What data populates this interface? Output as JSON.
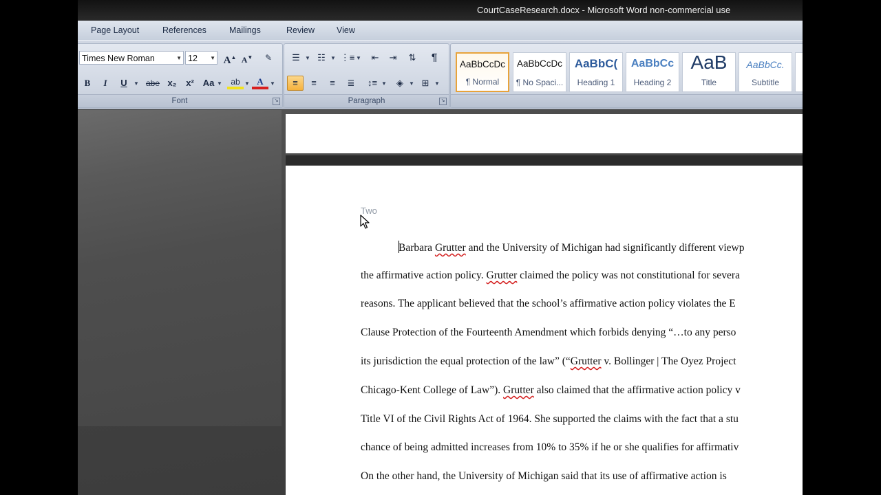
{
  "window": {
    "title": "CourtCaseResearch.docx - Microsoft Word non-commercial use"
  },
  "ribbon": {
    "tabs": [
      "Page Layout",
      "References",
      "Mailings",
      "Review",
      "View"
    ],
    "font_group": {
      "label": "Font",
      "font_name": "Times New Roman",
      "font_size": "12",
      "bold": "B",
      "italic": "I",
      "underline": "U",
      "strikethrough": "abe",
      "subscript": "x₂",
      "superscript": "x²",
      "change_case": "Aa",
      "grow_font": "A",
      "shrink_font": "A",
      "font_color": "A",
      "highlight": "ab"
    },
    "paragraph_group": {
      "label": "Paragraph",
      "show_marks": "¶"
    },
    "styles_group": {
      "styles": [
        {
          "preview": "AaBbCcDc",
          "name": "¶ Normal",
          "selected": true
        },
        {
          "preview": "AaBbCcDc",
          "name": "¶ No Spaci...",
          "selected": false
        },
        {
          "preview": "AaBbC(",
          "name": "Heading 1",
          "selected": false
        },
        {
          "preview": "AaBbCc",
          "name": "Heading 2",
          "selected": false
        },
        {
          "preview": "AaB",
          "name": "Title",
          "selected": false
        },
        {
          "preview": "AaBbCc.",
          "name": "Subtitle",
          "selected": false
        }
      ]
    }
  },
  "document": {
    "header": "Two",
    "lines": [
      {
        "segments": [
          {
            "t": "Barbara ",
            "sq": false
          },
          {
            "t": "Grutter",
            "sq": true
          },
          {
            "t": " and the University of Michigan  had significantly  different  viewp",
            "sq": false
          }
        ]
      },
      {
        "segments": [
          {
            "t": "the affirmative action policy.  ",
            "sq": false
          },
          {
            "t": "Grutter",
            "sq": true
          },
          {
            "t": " claimed  the policy was not constitutional for severa",
            "sq": false
          }
        ]
      },
      {
        "segments": [
          {
            "t": "reasons.  The  applicant  believed  that the school’s  affirmative  action policy  violates  the E",
            "sq": false
          }
        ]
      },
      {
        "segments": [
          {
            "t": "Clause Protection of the Fourteenth Amendment which forbids denying  “…to any perso",
            "sq": false
          }
        ]
      },
      {
        "segments": [
          {
            "t": "its jurisdiction  the equal protection of the law” (“",
            "sq": false
          },
          {
            "t": "Grutter",
            "sq": true
          },
          {
            "t": " v.  Bollinger  |  The  Oyez Project",
            "sq": false
          }
        ]
      },
      {
        "segments": [
          {
            "t": "Chicago-Kent College of Law”).  ",
            "sq": false
          },
          {
            "t": "Grutter",
            "sq": true
          },
          {
            "t": " also  claimed  that the affirmative  action policy  v",
            "sq": false
          }
        ]
      },
      {
        "segments": [
          {
            "t": "Title VI of the Civil Rights Act of 1964.  She supported the claims  with the fact that a stu",
            "sq": false
          }
        ]
      },
      {
        "segments": [
          {
            "t": "chance of being admitted increases  from  10% to 35% if he or she qualifies  for affirmativ",
            "sq": false
          }
        ]
      },
      {
        "segments": [
          {
            "t": "On the other hand, the University of Michigan  said that its use of affirmative action is",
            "sq": false
          }
        ]
      }
    ]
  },
  "colors": {
    "ribbon_bg": "#c8d0dd",
    "active_style_border": "#e8a33a",
    "squiggle": "#d42020"
  }
}
